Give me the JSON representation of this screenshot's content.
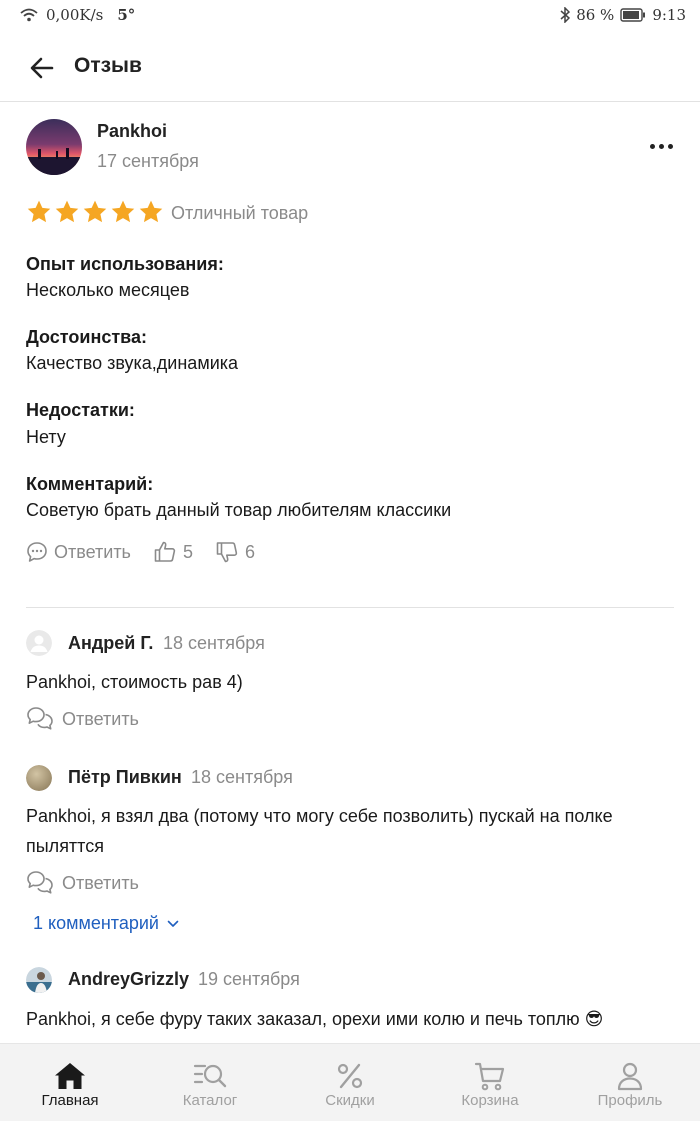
{
  "status_bar": {
    "speed": "0,00K/s",
    "temp": "5°",
    "battery": "86 %",
    "time": "9:13"
  },
  "header": {
    "title": "Отзыв"
  },
  "review": {
    "author": "Pankhoi",
    "date": "17 сентября",
    "rating": 5,
    "rating_text": "Отличный товар",
    "fields": [
      {
        "label": "Опыт использования:",
        "value": "Несколько месяцев"
      },
      {
        "label": "Достоинства:",
        "value": "Качество звука,динамика"
      },
      {
        "label": "Недостатки:",
        "value": "Нету"
      },
      {
        "label": "Комментарий:",
        "value": "Советую брать данный товар любителям классики"
      }
    ],
    "reply_label": "Ответить",
    "likes": "5",
    "dislikes": "6"
  },
  "comments": [
    {
      "author": "Андрей Г.",
      "date": "18 сентября",
      "text": "Pankhoi, стоимость рав 4)",
      "reply_label": "Ответить"
    },
    {
      "author": "Пётр Пивкин",
      "date": "18 сентября",
      "text": "Pankhoi, я взял два (потому что могу себе позволить) пускай на полке пыляттся",
      "reply_label": "Ответить",
      "more_label": "1 комментарий"
    },
    {
      "author": "AndreyGrizzly",
      "date": "19 сентября",
      "text": "Pankhoi, я себе фуру таких заказал, орехи ими колю и печь топлю 😎"
    }
  ],
  "bottom_nav": [
    {
      "label": "Главная",
      "icon": "home-icon",
      "active": true
    },
    {
      "label": "Каталог",
      "icon": "catalog-search-icon",
      "active": false
    },
    {
      "label": "Скидки",
      "icon": "percent-icon",
      "active": false
    },
    {
      "label": "Корзина",
      "icon": "cart-icon",
      "active": false
    },
    {
      "label": "Профиль",
      "icon": "profile-icon",
      "active": false
    }
  ],
  "colors": {
    "star": "#f5a623",
    "link": "#1f5fbf",
    "muted": "#8a8a8a",
    "active_nav": "#1a1a1a",
    "inactive_nav": "#a0a0a0"
  }
}
